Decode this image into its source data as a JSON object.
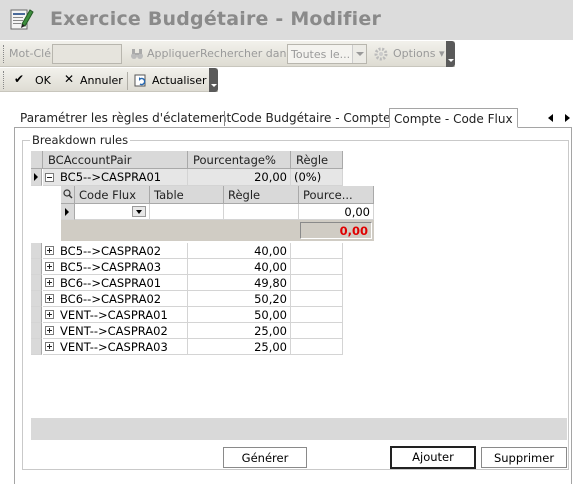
{
  "window": {
    "title": "Exercice Budgétaire - Modifier"
  },
  "toolbar": {
    "keyword_label": "Mot-Clé",
    "keyword_value": "",
    "apply_label": "Appliquer",
    "search_in_label": "Rechercher dans",
    "search_in_value": "Toutes le...",
    "options_label": "Options",
    "ok_label": "OK",
    "cancel_label": "Annuler",
    "refresh_label": "Actualiser"
  },
  "tabs": [
    {
      "label": "Paramétrer les règles d'éclatement"
    },
    {
      "label": "Code Budgétaire - Compte"
    },
    {
      "label": "Compte - Code Flux"
    }
  ],
  "group": {
    "legend": "Breakdown rules"
  },
  "grid": {
    "columns": [
      "BCAccountPair",
      "Pourcentage%",
      "Règle"
    ],
    "expanded_row": {
      "pair": "BC5-->CASPRA01",
      "percent": "20,00",
      "rule": "(0%)"
    },
    "detail": {
      "columns": [
        "Code Flux",
        "Table",
        "Règle",
        "Pource..."
      ],
      "row": {
        "code_flux": "",
        "table": "",
        "rule": "",
        "percent": "0,00"
      },
      "total": "0,00"
    },
    "rows": [
      {
        "pair": "BC5-->CASPRA02",
        "percent": "40,00",
        "rule": ""
      },
      {
        "pair": "BC5-->CASPRA03",
        "percent": "40,00",
        "rule": ""
      },
      {
        "pair": "BC6-->CASPRA01",
        "percent": "49,80",
        "rule": ""
      },
      {
        "pair": "BC6-->CASPRA02",
        "percent": "50,20",
        "rule": ""
      },
      {
        "pair": "VENT-->CASPRA01",
        "percent": "50,00",
        "rule": ""
      },
      {
        "pair": "VENT-->CASPRA02",
        "percent": "25,00",
        "rule": ""
      },
      {
        "pair": "VENT-->CASPRA03",
        "percent": "25,00",
        "rule": ""
      }
    ]
  },
  "buttons": {
    "generate": "Générer",
    "add": "Ajouter",
    "delete": "Supprimer"
  },
  "colors": {
    "accent_red": "#e00000",
    "title_gray": "#8a8a8a",
    "header_gray": "#d9d9d9"
  }
}
